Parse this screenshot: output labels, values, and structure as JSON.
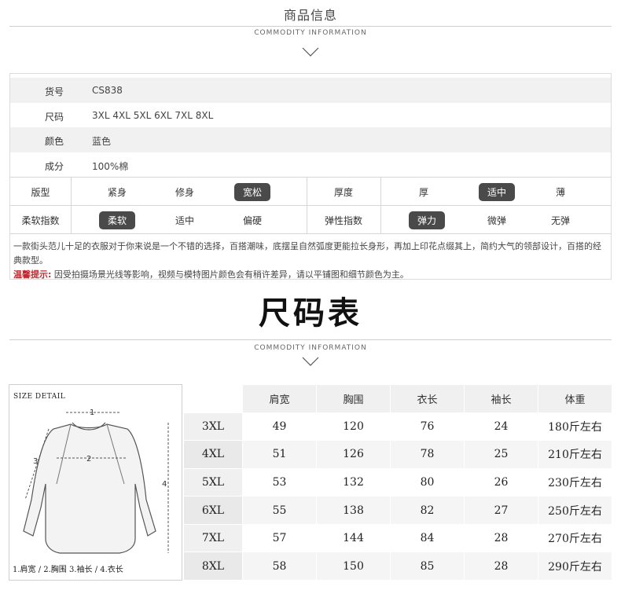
{
  "header1": {
    "title": "商品信息",
    "subtitle": "COMMODITY INFORMATION"
  },
  "info": {
    "rows": [
      {
        "label": "货号",
        "value": "CS838"
      },
      {
        "label": "尺码",
        "value": "3XL 4XL 5XL 6XL 7XL 8XL"
      },
      {
        "label": "颜色",
        "value": "蓝色"
      },
      {
        "label": "成分",
        "value": "100%棉"
      }
    ],
    "fit": {
      "label": "版型",
      "options": [
        "紧身",
        "修身",
        "宽松"
      ],
      "selected": "宽松"
    },
    "thickness": {
      "label": "厚度",
      "options": [
        "厚",
        "适中",
        "薄"
      ],
      "selected": "适中"
    },
    "softness": {
      "label": "柔软指数",
      "options": [
        "柔软",
        "适中",
        "偏硬"
      ],
      "selected": "柔软"
    },
    "elasticity": {
      "label": "弹性指数",
      "options": [
        "弹力",
        "微弹",
        "无弹"
      ],
      "selected": "弹力"
    },
    "description": "一款街头范儿十足的衣服对于你来说是一个不错的选择，百搭潮味，底摆呈自然弧度更能拉长身形，再加上印花点缀其上，简约大气的领部设计，百搭的经典款型。",
    "tip_label": "温馨提示:",
    "tip_text": "因受拍摄场景光线等影响，视频与模特图片颜色会有稍许差异，请以平铺图和细节颜色为主。"
  },
  "size_chart": {
    "title": "尺码表",
    "subtitle": "COMMODITY INFORMATION",
    "detail_title": "SIZE DETAIL",
    "legend": "1.肩宽 / 2.胸围  3.袖长 / 4.衣长",
    "diagram_numbers": [
      "1",
      "2",
      "3",
      "4"
    ],
    "columns": [
      "肩宽",
      "胸围",
      "衣长",
      "袖长",
      "体重"
    ],
    "rows": [
      {
        "size": "3XL",
        "values": [
          "49",
          "120",
          "76",
          "24",
          "180斤左右"
        ]
      },
      {
        "size": "4XL",
        "values": [
          "51",
          "126",
          "78",
          "25",
          "210斤左右"
        ]
      },
      {
        "size": "5XL",
        "values": [
          "53",
          "132",
          "80",
          "26",
          "230斤左右"
        ]
      },
      {
        "size": "6XL",
        "values": [
          "55",
          "138",
          "82",
          "27",
          "250斤左右"
        ]
      },
      {
        "size": "7XL",
        "values": [
          "57",
          "144",
          "84",
          "28",
          "270斤左右"
        ]
      },
      {
        "size": "8XL",
        "values": [
          "58",
          "150",
          "85",
          "28",
          "290斤左右"
        ]
      }
    ]
  },
  "colors": {
    "pill": "#4a4a4a",
    "warn": "#c2272d",
    "shade": "#f1f1f1"
  }
}
